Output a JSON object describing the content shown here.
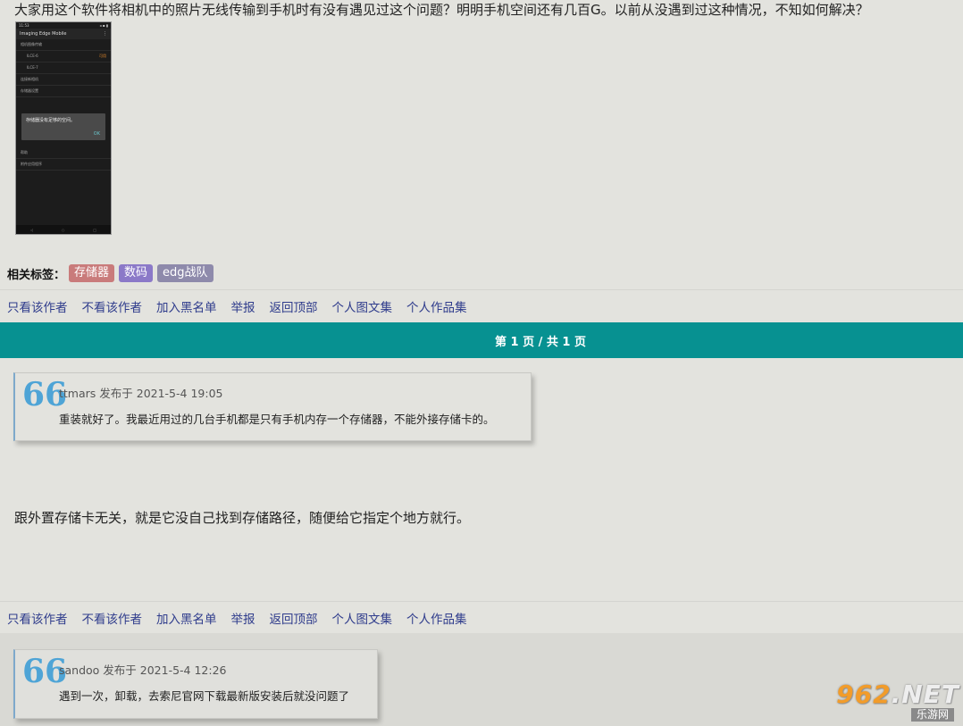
{
  "post": {
    "text": "大家用这个软件将相机中的照片无线传输到手机时有没有遇见过这个问题？明明手机空间还有几百G。以前从没遇到过这种情况，不知如何解决？"
  },
  "phone": {
    "status_left": "11:53",
    "status_right": "◂ ▪ ▮",
    "app_title": "Imaging Edge Mobile",
    "app_menu": "⋮",
    "rows": [
      "相机图像传输",
      "ILCE-6",
      "ILCE-7",
      "连接新相机",
      "存储器设置"
    ],
    "badge": "可用",
    "dialog_text": "存储器没有足够的空间。",
    "dialog_ok": "OK",
    "lower_rows": [
      "帮助",
      "附件应用程序"
    ],
    "nav": [
      "◁",
      "○",
      "□"
    ]
  },
  "tags": {
    "label": "相关标签：",
    "items": [
      {
        "text": "存储器",
        "color": "#c97b7b"
      },
      {
        "text": "数码",
        "color": "#8b79c8"
      },
      {
        "text": "edg战队",
        "color": "#8e8aab"
      }
    ]
  },
  "actions": [
    "只看该作者",
    "不看该作者",
    "加入黑名单",
    "举报",
    "返回顶部",
    "个人图文集",
    "个人作品集"
  ],
  "pager": {
    "text": "第 1 页 / 共 1 页"
  },
  "reply1": {
    "quote_mark": "66",
    "author_meta": "ttmars 发布于 2021-5-4 19:05",
    "quote_text": "重装就好了。我最近用过的几台手机都是只有手机内存一个存储器，不能外接存储卡的。",
    "text": "跟外置存储卡无关，就是它没自己找到存储路径，随便给它指定个地方就行。"
  },
  "reply2": {
    "quote_mark": "66",
    "author_meta": "sandoo 发布于 2021-5-4 12:26",
    "quote_text": "遇到一次，卸载，去索尼官网下载最新版安装后就没问题了"
  },
  "watermark": {
    "number": "962",
    "suffix": ".NET",
    "sub": "乐游网"
  }
}
